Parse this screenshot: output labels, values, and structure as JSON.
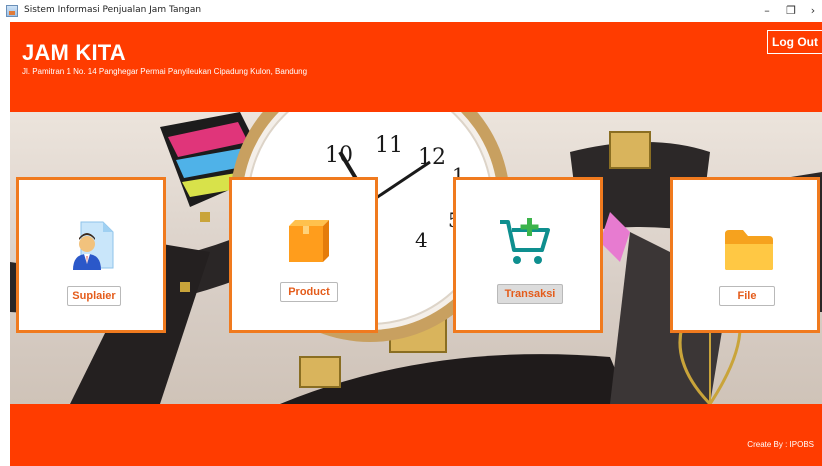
{
  "window": {
    "title": "Sistem Informasi Penjualan Jam Tangan",
    "minimize_glyph": "–",
    "maximize_glyph": "❐",
    "close_glyph": "›"
  },
  "header": {
    "title": "JAM KITA",
    "address": "Jl. Pamitran 1 No. 14 Panghegar Permai Panyileukan Cipadung Kulon, Bandung",
    "logout_label": "Log Out"
  },
  "banner": {
    "watch_numerals": [
      "10",
      "11",
      "12",
      "1",
      "4",
      "5"
    ]
  },
  "menu": [
    {
      "label": "Suplaier",
      "icon": "supplier-icon"
    },
    {
      "label": "Product",
      "icon": "box-icon"
    },
    {
      "label": "Transaksi",
      "icon": "cart-add-icon"
    },
    {
      "label": "File",
      "icon": "folder-icon"
    }
  ],
  "footer": {
    "credit": "Create By : IPOBS"
  },
  "colors": {
    "brand_orange": "#ff3c00",
    "card_border": "#f07a1e",
    "button_text": "#e45c1b"
  }
}
